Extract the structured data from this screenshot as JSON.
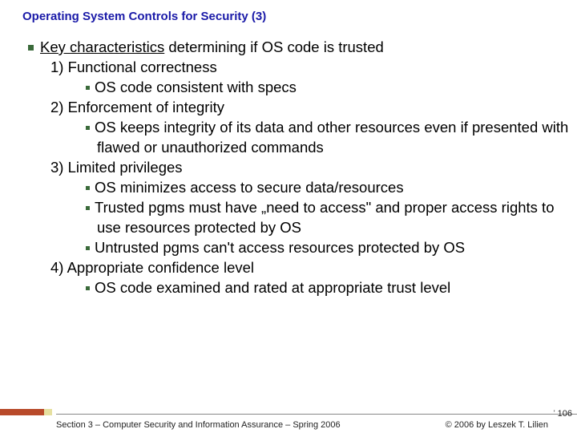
{
  "title": "Operating System Controls for Security (3)",
  "main": {
    "lead": "Key characteristics",
    "lead_rest": " determining if OS code is trusted",
    "items": [
      {
        "num": "1)",
        "label": "Functional correctness",
        "subs": [
          "OS code consistent with specs"
        ]
      },
      {
        "num": "2)",
        "label": "Enforcement of integrity",
        "subs": [
          "OS keeps integrity of its data and other resources even if presented with flawed or unauthorized commands"
        ]
      },
      {
        "num": "3)",
        "label": "Limited privileges",
        "subs": [
          "OS minimizes access to secure data/resources",
          "Trusted pgms must have „need to access\" and proper access rights to use resources protected by OS",
          "Untrusted pgms can't access resources protected by OS"
        ]
      },
      {
        "num": "4)",
        "label": "Appropriate confidence level",
        "subs": [
          "OS code examined and rated at appropriate trust level"
        ]
      }
    ]
  },
  "footer": {
    "left": "Section 3 – Computer Security and Information Assurance – Spring 2006",
    "right": "© 2006 by Leszek T. Lilien",
    "page": "106"
  }
}
